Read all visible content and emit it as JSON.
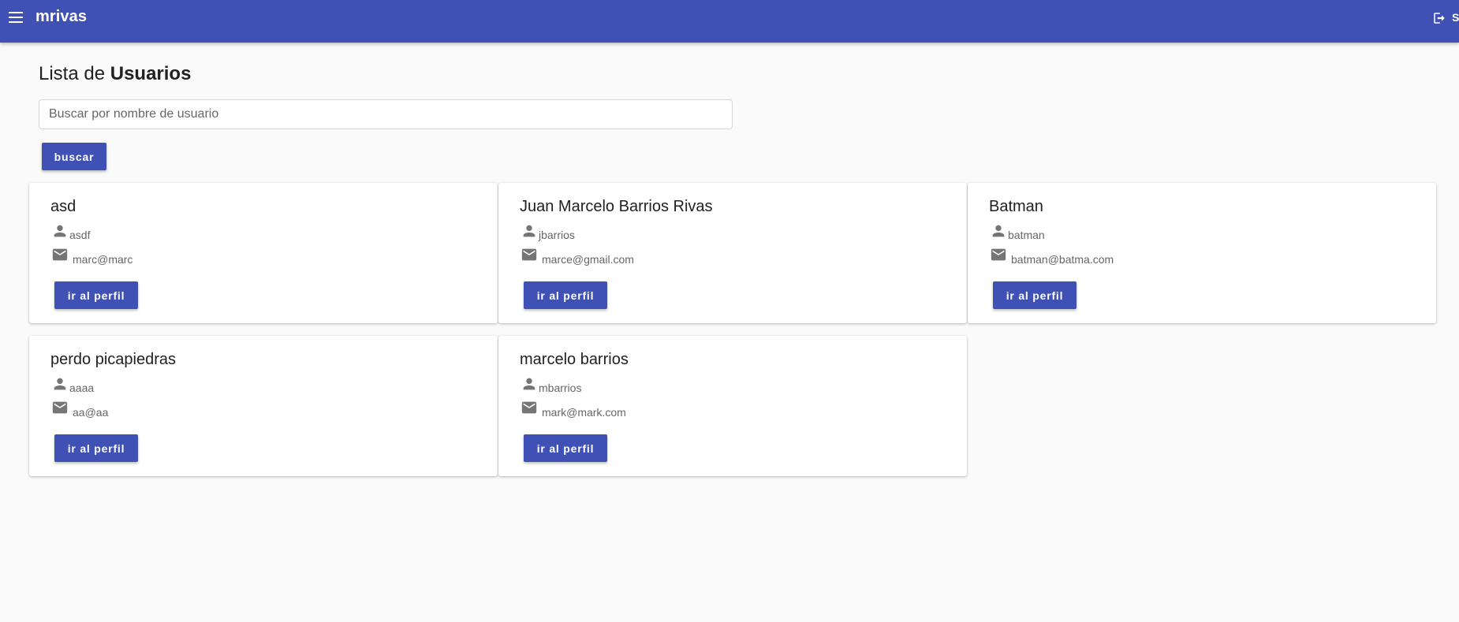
{
  "header": {
    "brand": "mrivas",
    "logout_label": "S",
    "menu_icon": "menu-icon",
    "logout_icon": "logout-icon",
    "color": "#3f51b5"
  },
  "page": {
    "title_prefix": "Lista de",
    "title_bold": "Usuarios"
  },
  "search": {
    "placeholder": "Buscar por nombre de usuario",
    "value": "",
    "button_label": "buscar"
  },
  "users": [
    {
      "name": "asd",
      "username": "asdf",
      "email": "marc@marc",
      "button_label": "ir al perfil"
    },
    {
      "name": "Juan Marcelo Barrios Rivas",
      "username": "jbarrios",
      "email": "marce@gmail.com",
      "button_label": "ir al perfil"
    },
    {
      "name": "Batman",
      "username": "batman",
      "email": "batman@batma.com",
      "button_label": "ir al perfil"
    },
    {
      "name": "perdo picapiedras",
      "username": "aaaa",
      "email": "aa@aa",
      "button_label": "ir al perfil"
    },
    {
      "name": "marcelo barrios",
      "username": "mbarrios",
      "email": "mark@mark.com",
      "button_label": "ir al perfil"
    }
  ]
}
